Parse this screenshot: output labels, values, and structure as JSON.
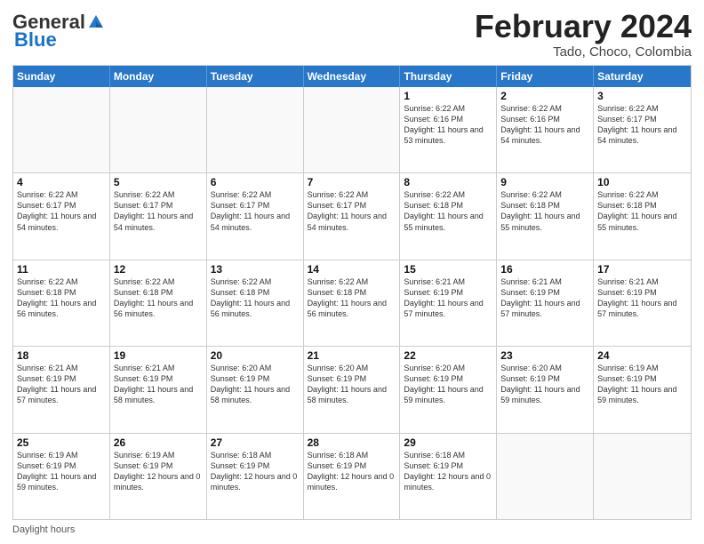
{
  "header": {
    "logo_general": "General",
    "logo_blue": "Blue",
    "month_title": "February 2024",
    "location": "Tado, Choco, Colombia"
  },
  "footer": {
    "daylight_label": "Daylight hours"
  },
  "weekdays": [
    "Sunday",
    "Monday",
    "Tuesday",
    "Wednesday",
    "Thursday",
    "Friday",
    "Saturday"
  ],
  "rows": [
    [
      {
        "day": "",
        "empty": true
      },
      {
        "day": "",
        "empty": true
      },
      {
        "day": "",
        "empty": true
      },
      {
        "day": "",
        "empty": true
      },
      {
        "day": "1",
        "sunrise": "Sunrise: 6:22 AM",
        "sunset": "Sunset: 6:16 PM",
        "daylight": "Daylight: 11 hours and 53 minutes."
      },
      {
        "day": "2",
        "sunrise": "Sunrise: 6:22 AM",
        "sunset": "Sunset: 6:16 PM",
        "daylight": "Daylight: 11 hours and 54 minutes."
      },
      {
        "day": "3",
        "sunrise": "Sunrise: 6:22 AM",
        "sunset": "Sunset: 6:17 PM",
        "daylight": "Daylight: 11 hours and 54 minutes."
      }
    ],
    [
      {
        "day": "4",
        "sunrise": "Sunrise: 6:22 AM",
        "sunset": "Sunset: 6:17 PM",
        "daylight": "Daylight: 11 hours and 54 minutes."
      },
      {
        "day": "5",
        "sunrise": "Sunrise: 6:22 AM",
        "sunset": "Sunset: 6:17 PM",
        "daylight": "Daylight: 11 hours and 54 minutes."
      },
      {
        "day": "6",
        "sunrise": "Sunrise: 6:22 AM",
        "sunset": "Sunset: 6:17 PM",
        "daylight": "Daylight: 11 hours and 54 minutes."
      },
      {
        "day": "7",
        "sunrise": "Sunrise: 6:22 AM",
        "sunset": "Sunset: 6:17 PM",
        "daylight": "Daylight: 11 hours and 54 minutes."
      },
      {
        "day": "8",
        "sunrise": "Sunrise: 6:22 AM",
        "sunset": "Sunset: 6:18 PM",
        "daylight": "Daylight: 11 hours and 55 minutes."
      },
      {
        "day": "9",
        "sunrise": "Sunrise: 6:22 AM",
        "sunset": "Sunset: 6:18 PM",
        "daylight": "Daylight: 11 hours and 55 minutes."
      },
      {
        "day": "10",
        "sunrise": "Sunrise: 6:22 AM",
        "sunset": "Sunset: 6:18 PM",
        "daylight": "Daylight: 11 hours and 55 minutes."
      }
    ],
    [
      {
        "day": "11",
        "sunrise": "Sunrise: 6:22 AM",
        "sunset": "Sunset: 6:18 PM",
        "daylight": "Daylight: 11 hours and 56 minutes."
      },
      {
        "day": "12",
        "sunrise": "Sunrise: 6:22 AM",
        "sunset": "Sunset: 6:18 PM",
        "daylight": "Daylight: 11 hours and 56 minutes."
      },
      {
        "day": "13",
        "sunrise": "Sunrise: 6:22 AM",
        "sunset": "Sunset: 6:18 PM",
        "daylight": "Daylight: 11 hours and 56 minutes."
      },
      {
        "day": "14",
        "sunrise": "Sunrise: 6:22 AM",
        "sunset": "Sunset: 6:18 PM",
        "daylight": "Daylight: 11 hours and 56 minutes."
      },
      {
        "day": "15",
        "sunrise": "Sunrise: 6:21 AM",
        "sunset": "Sunset: 6:19 PM",
        "daylight": "Daylight: 11 hours and 57 minutes."
      },
      {
        "day": "16",
        "sunrise": "Sunrise: 6:21 AM",
        "sunset": "Sunset: 6:19 PM",
        "daylight": "Daylight: 11 hours and 57 minutes."
      },
      {
        "day": "17",
        "sunrise": "Sunrise: 6:21 AM",
        "sunset": "Sunset: 6:19 PM",
        "daylight": "Daylight: 11 hours and 57 minutes."
      }
    ],
    [
      {
        "day": "18",
        "sunrise": "Sunrise: 6:21 AM",
        "sunset": "Sunset: 6:19 PM",
        "daylight": "Daylight: 11 hours and 57 minutes."
      },
      {
        "day": "19",
        "sunrise": "Sunrise: 6:21 AM",
        "sunset": "Sunset: 6:19 PM",
        "daylight": "Daylight: 11 hours and 58 minutes."
      },
      {
        "day": "20",
        "sunrise": "Sunrise: 6:20 AM",
        "sunset": "Sunset: 6:19 PM",
        "daylight": "Daylight: 11 hours and 58 minutes."
      },
      {
        "day": "21",
        "sunrise": "Sunrise: 6:20 AM",
        "sunset": "Sunset: 6:19 PM",
        "daylight": "Daylight: 11 hours and 58 minutes."
      },
      {
        "day": "22",
        "sunrise": "Sunrise: 6:20 AM",
        "sunset": "Sunset: 6:19 PM",
        "daylight": "Daylight: 11 hours and 59 minutes."
      },
      {
        "day": "23",
        "sunrise": "Sunrise: 6:20 AM",
        "sunset": "Sunset: 6:19 PM",
        "daylight": "Daylight: 11 hours and 59 minutes."
      },
      {
        "day": "24",
        "sunrise": "Sunrise: 6:19 AM",
        "sunset": "Sunset: 6:19 PM",
        "daylight": "Daylight: 11 hours and 59 minutes."
      }
    ],
    [
      {
        "day": "25",
        "sunrise": "Sunrise: 6:19 AM",
        "sunset": "Sunset: 6:19 PM",
        "daylight": "Daylight: 11 hours and 59 minutes."
      },
      {
        "day": "26",
        "sunrise": "Sunrise: 6:19 AM",
        "sunset": "Sunset: 6:19 PM",
        "daylight": "Daylight: 12 hours and 0 minutes."
      },
      {
        "day": "27",
        "sunrise": "Sunrise: 6:18 AM",
        "sunset": "Sunset: 6:19 PM",
        "daylight": "Daylight: 12 hours and 0 minutes."
      },
      {
        "day": "28",
        "sunrise": "Sunrise: 6:18 AM",
        "sunset": "Sunset: 6:19 PM",
        "daylight": "Daylight: 12 hours and 0 minutes."
      },
      {
        "day": "29",
        "sunrise": "Sunrise: 6:18 AM",
        "sunset": "Sunset: 6:19 PM",
        "daylight": "Daylight: 12 hours and 0 minutes."
      },
      {
        "day": "",
        "empty": true
      },
      {
        "day": "",
        "empty": true
      }
    ]
  ]
}
